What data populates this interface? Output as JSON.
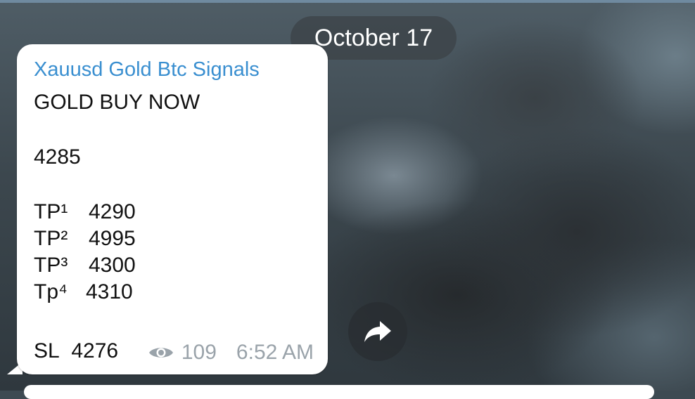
{
  "chat": {
    "date_separator": "October 17",
    "message": {
      "sender": "Xauusd Gold Btc Signals",
      "headline": "GOLD BUY NOW",
      "entry_price": "4285",
      "targets": [
        {
          "label": "TP¹",
          "value": "4290"
        },
        {
          "label": "TP²",
          "value": "4995"
        },
        {
          "label": "TP³",
          "value": "4300"
        },
        {
          "label": "Tp⁴",
          "value": "4310"
        }
      ],
      "stop_loss": {
        "label": "SL",
        "value": "4276"
      },
      "views": "109",
      "time": "6:52 AM"
    },
    "forward_icon": "forward-arrow-icon",
    "colors": {
      "sender": "#3a8fd0",
      "meta": "#9aa3aa",
      "bubble": "#ffffff"
    }
  }
}
